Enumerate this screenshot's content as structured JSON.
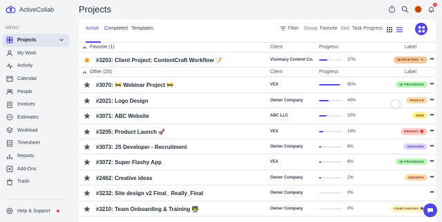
{
  "app": {
    "name": "ActiveCollab",
    "page_title": "Projects"
  },
  "sidebar": {
    "menu_heading": "MENU",
    "items": [
      {
        "label": "Projects",
        "icon": "grid-icon",
        "active": true
      },
      {
        "label": "My Work",
        "icon": "user-icon"
      },
      {
        "label": "Activity",
        "icon": "pulse-icon"
      },
      {
        "label": "Calendar",
        "icon": "calendar-icon"
      },
      {
        "label": "People",
        "icon": "people-icon"
      },
      {
        "label": "Invoices",
        "icon": "invoice-icon"
      },
      {
        "label": "Estimates",
        "icon": "estimate-icon"
      },
      {
        "label": "Workload",
        "icon": "layers-icon"
      },
      {
        "label": "Timesheet",
        "icon": "timesheet-icon"
      },
      {
        "label": "Reports",
        "icon": "reports-icon"
      },
      {
        "label": "Add-Ons",
        "icon": "addons-icon"
      },
      {
        "label": "Trash",
        "icon": "trash-icon"
      }
    ],
    "help_label": "Help & Support"
  },
  "header": {
    "notification_count": "1"
  },
  "toolbar": {
    "tabs": [
      {
        "label": "Active"
      },
      {
        "label": "Completed"
      },
      {
        "label": "Templates"
      }
    ],
    "filter_label": "Filter",
    "group_prefix": "Group:",
    "group_value": "Favorite",
    "sort_prefix": "Sort:",
    "sort_value": "Task Progress"
  },
  "columns": {
    "client": "Client",
    "progress": "Progress",
    "label": "Label"
  },
  "groups": [
    {
      "title": "Favorite (1)",
      "rows": [
        {
          "name": "#3203: Client Project: ContentCraft Workflow 📝",
          "client": "Visionary Content Co.",
          "progress": 37,
          "progress_text": "37%",
          "label": "MARKETING 🐄",
          "label_bg": "#f5c89a",
          "label_fg": "#7c3a0a",
          "starred": true
        }
      ]
    },
    {
      "title": "Other (25)",
      "rows": [
        {
          "name": "#3070: 🚧 Webinar Project 🚧",
          "client": "VEX",
          "progress": 90,
          "progress_text": "90%",
          "label": "IN PROGRESS",
          "label_bg": "#bbf7b8",
          "label_fg": "#166534"
        },
        {
          "name": "#2021: Logo Design",
          "client": "Owner Company",
          "progress": 43,
          "progress_text": "43%",
          "label": "PEOPLE",
          "label_bg": "#fcd9a8",
          "label_fg": "#9a3412"
        },
        {
          "name": "#3071: ABC Website",
          "client": "ABC LLC",
          "progress": 32,
          "progress_text": "32%",
          "label": "NEW",
          "label_bg": "#fef08a",
          "label_fg": "#713f12"
        },
        {
          "name": "#3205: Product Launch 🚀",
          "client": "VEX",
          "progress": 19,
          "progress_text": "19%",
          "label": "URGENT 🔴",
          "label_bg": "#fecaca",
          "label_fg": "#991b1b"
        },
        {
          "name": "#3073: JS Developer - Recruitment",
          "client": "Owner Company",
          "progress": 8,
          "progress_text": "8%",
          "label": "ONGOING",
          "label_bg": "#ddd6fe",
          "label_fg": "#5b21b6"
        },
        {
          "name": "#3072: Super Flashy App",
          "client": "VEX",
          "progress": 6,
          "progress_text": "6%",
          "label": "IN PROGRESS",
          "label_bg": "#bbf7b8",
          "label_fg": "#166534"
        },
        {
          "name": "#2462: Creative ideas",
          "client": "Owner Company",
          "progress": 2,
          "progress_text": "2%",
          "label": "GROWTH",
          "label_bg": "#fed7aa",
          "label_fg": "#7c2d12"
        },
        {
          "name": "#3232: Site design v2 Final_ Really_Final",
          "client": "Owner Company",
          "progress": 0,
          "progress_text": "0%",
          "label": "",
          "label_bg": "",
          "label_fg": ""
        },
        {
          "name": "#3210: Team Onboarding & Training 👨‍🏫",
          "client": "Owner Company",
          "progress": 0,
          "progress_text": "0%",
          "label": "ONBOARDING 🎓",
          "label_bg": "#fef3c7",
          "label_fg": "#854d0e"
        }
      ]
    }
  ]
}
